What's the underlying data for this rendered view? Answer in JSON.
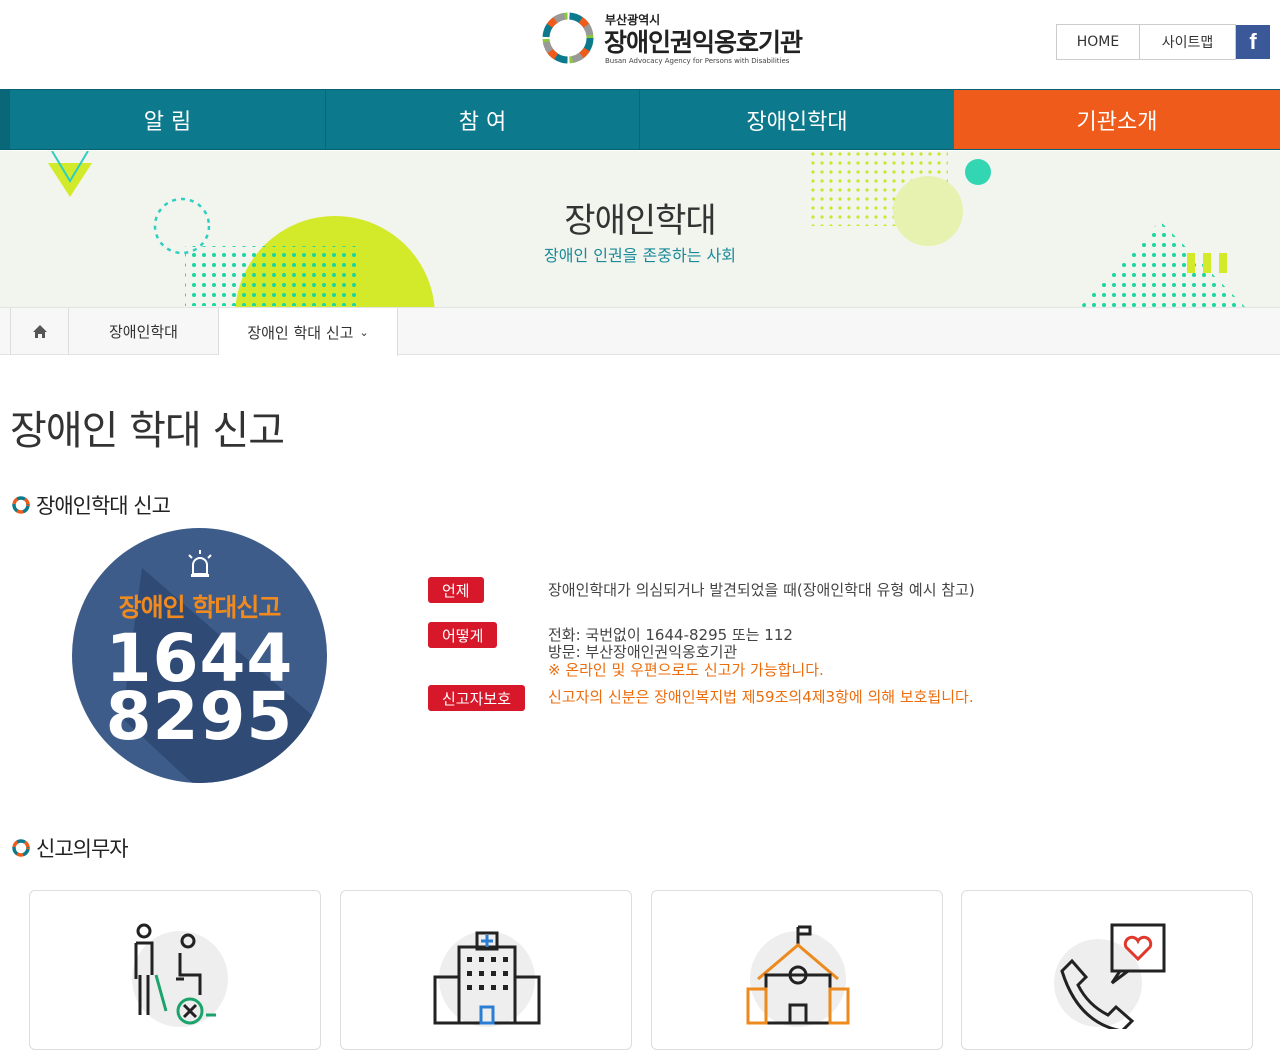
{
  "header": {
    "logo_sub": "부산광역시",
    "logo_title": "장애인권익옹호기관",
    "logo_en": "Busan Advocacy Agency for Persons with Disabilities",
    "util": {
      "home": "HOME",
      "sitemap": "사이트맵",
      "facebook": "f"
    }
  },
  "nav": {
    "items": [
      {
        "label": "알 림"
      },
      {
        "label": "참 여"
      },
      {
        "label": "장애인학대"
      },
      {
        "label": "기관소개"
      }
    ]
  },
  "banner": {
    "title": "장애인학대",
    "subtitle": "장애인 인권을 존중하는 사회"
  },
  "breadcrumb": {
    "level1": "장애인학대",
    "level2": "장애인 학대 신고"
  },
  "page_title": "장애인 학대 신고",
  "section1": {
    "title": "장애인학대 신고",
    "badge": {
      "label": "장애인 학대신고",
      "number_line1": "1644",
      "number_line2": "8295"
    },
    "rows": [
      {
        "tag": "언제",
        "lines": [
          "장애인학대가 의심되거나 발견되었을 때(장애인학대 유형 예시 참고)"
        ]
      },
      {
        "tag": "어떻게",
        "lines": [
          "전화: 국번없이 1644-8295 또는 112",
          "방문: 부산장애인권익옹호기관",
          "※ 온라인 및 우편으로도 신고가 가능합니다."
        ]
      },
      {
        "tag": "신고자보호",
        "lines": [
          "신고자의 신분은 장애인복지법 제59조의4제3항에 의해 보호됩니다."
        ]
      }
    ]
  },
  "section2": {
    "title": "신고의무자"
  },
  "colors": {
    "nav": "#0c7a8c",
    "nav_active": "#ee5b1a",
    "tag": "#d7182a",
    "accent_orange": "#ec6d0e",
    "teal_text": "#1a8a99"
  }
}
